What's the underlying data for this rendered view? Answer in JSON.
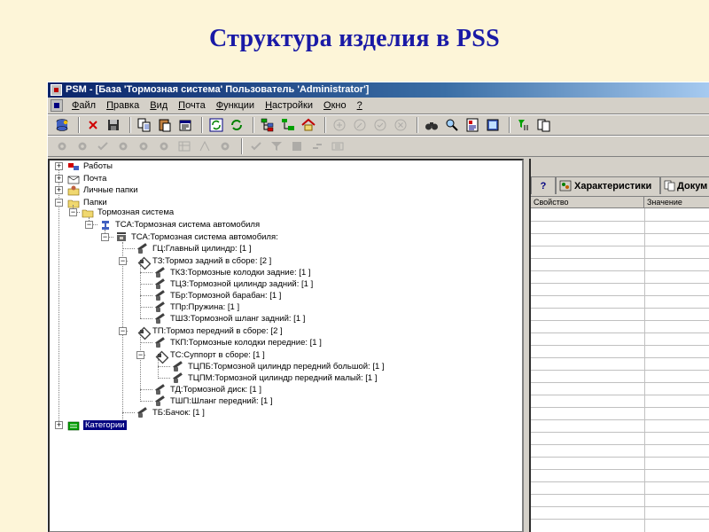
{
  "slide": {
    "title": "Структура изделия в PSS"
  },
  "window": {
    "title": "PSM - [База 'Тормозная система' Пользователь 'Administrator']"
  },
  "menu": [
    {
      "label": "Файл",
      "ul": "Ф",
      "rest": "айл"
    },
    {
      "label": "Правка",
      "ul": "П",
      "rest": "равка"
    },
    {
      "label": "Вид",
      "ul": "В",
      "rest": "ид"
    },
    {
      "label": "Почта",
      "ul": "П",
      "rest": "очта"
    },
    {
      "label": "Функции",
      "ul": "Ф",
      "rest": "ункции"
    },
    {
      "label": "Настройки",
      "ul": "Н",
      "rest": "астройки"
    },
    {
      "label": "Окно",
      "ul": "О",
      "rest": "кно"
    },
    {
      "label": "?",
      "ul": "?",
      "rest": ""
    }
  ],
  "tree": {
    "nodes": [
      "Работы",
      "Почта",
      "Личные папки",
      "Папки",
      "Тормозная система",
      "ТСА:Тормозная система автомобиля",
      "ТСА:Тормозная система автомобиля:",
      "ГЦ:Главный цилиндр: [1 ]",
      "ТЗ:Тормоз задний в сборе: [2 ]",
      "ТКЗ:Тормозные колодки задние: [1 ]",
      "ТЦЗ:Тормозной цилиндр задний: [1 ]",
      "ТБр:Тормозной барабан: [1 ]",
      "ТПр:Пружина: [1 ]",
      "ТШЗ:Тормозной шланг задний: [1 ]",
      "ТП:Тормоз передний в сборе: [2 ]",
      "ТКП:Тормозные колодки передние: [1 ]",
      "ТС:Суппорт в сборе: [1 ]",
      "ТЦПБ:Тормозной цилиндр передний большой: [1 ]",
      "ТЦПМ:Тормозной цилиндр передний малый: [1 ]",
      "ТД:Тормозной диск: [1 ]",
      "ТШП:Шланг передний: [1 ]",
      "ТБ:Бачок: [1 ]",
      "Категории"
    ]
  },
  "props": {
    "tab_help": "?",
    "tab_characteristics": "Характеристики",
    "tab_documents": "Докум",
    "col_property": "Свойство",
    "col_value": "Значение"
  }
}
